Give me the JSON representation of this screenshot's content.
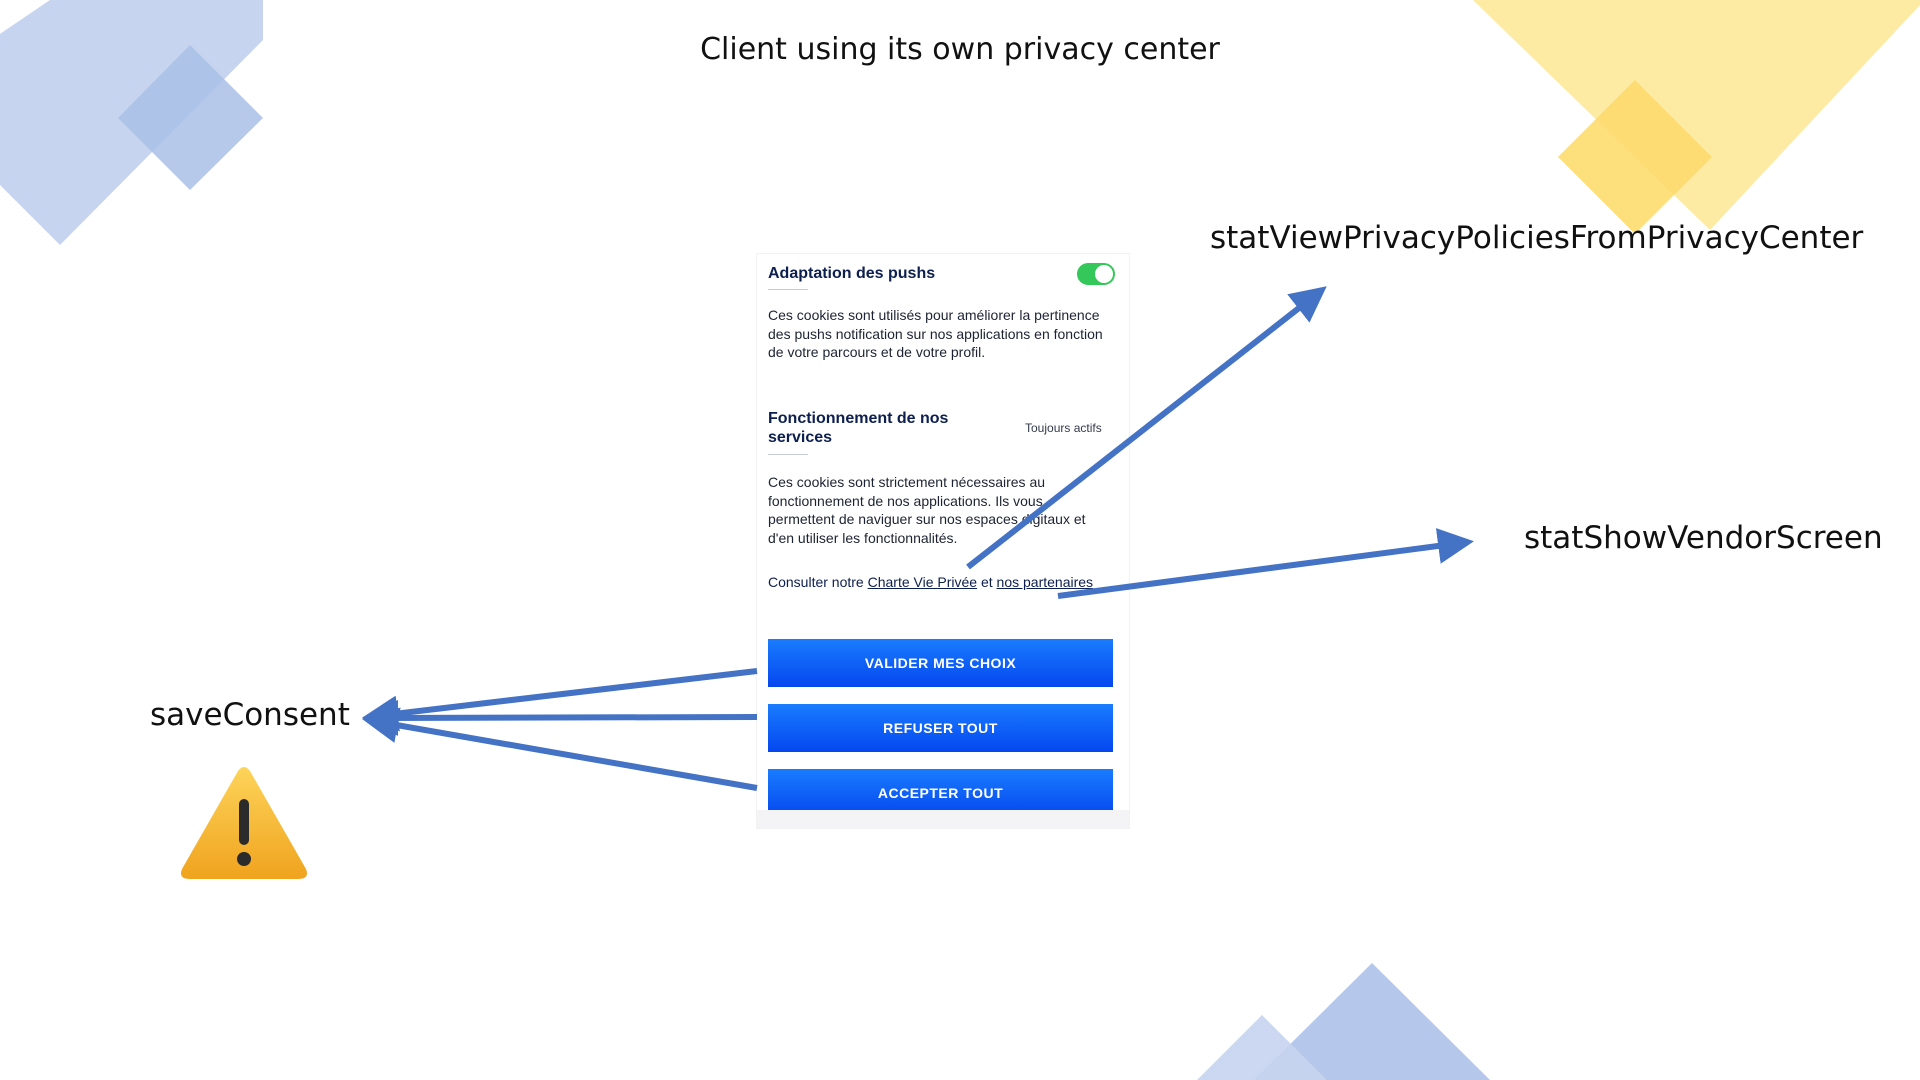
{
  "title": "Client using its own privacy center",
  "callouts": {
    "privacy_center": "statViewPrivacyPoliciesFromPrivacyCenter",
    "vendor_screen": "statShowVendorScreen",
    "save_consent": "saveConsent"
  },
  "phone": {
    "section1": {
      "title": "Adaptation des pushs",
      "toggle_on": true,
      "description": "Ces cookies sont utilisés pour améliorer la pertinence des pushs notification sur nos applications en fonction de votre parcours et de votre profil."
    },
    "section2": {
      "title": "Fonctionnement de nos services",
      "status": "Toujours actifs",
      "description": "Ces cookies sont strictement nécessaires au fonctionnement de nos applications. Ils vous permettent de naviguer sur nos espaces digitaux et d'en utiliser les fonctionnalités."
    },
    "links": {
      "prefix": "Consulter notre",
      "privacy_link": "Charte Vie Privée",
      "and": "et",
      "partners_link": "nos partenaires"
    },
    "buttons": {
      "validate": "VALIDER MES CHOIX",
      "refuse": "REFUSER TOUT",
      "accept": "ACCEPTER TOUT"
    }
  },
  "icons": {
    "warning": "warning-icon"
  },
  "colors": {
    "arrow": "#4472c4",
    "button": "#0a5cf5",
    "toggle": "#34c759",
    "decor_blue": "#a9bfe6",
    "decor_yellow": "#fde48a"
  }
}
